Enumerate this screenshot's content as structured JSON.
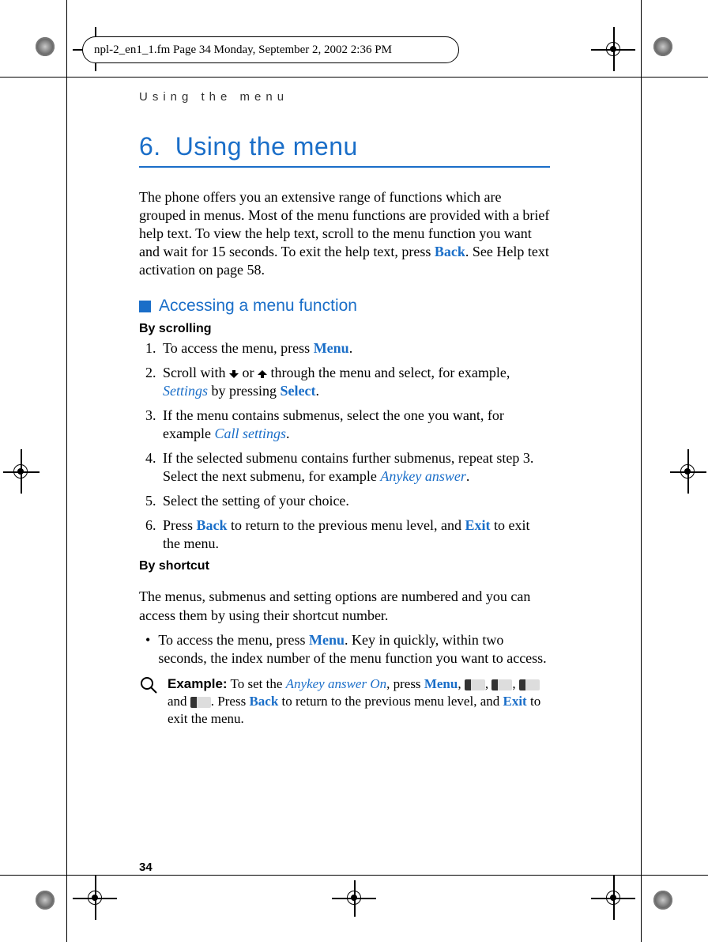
{
  "file_header": "npl-2_en1_1.fm  Page 34  Monday, September 2, 2002  2:36 PM",
  "running_head": "Using the menu",
  "chapter": {
    "num": "6.",
    "title": "Using the menu"
  },
  "intro": {
    "t1": "The phone offers you an extensive range of functions which are grouped in menus. Most of the menu functions are provided with a brief help text. To view the help text, scroll to the menu function you want and wait for 15 seconds. To exit the help text, press ",
    "back": "Back",
    "t2": ". See Help text activation on page 58."
  },
  "section1": {
    "title": "Accessing a menu function",
    "by_scrolling": "By scrolling",
    "steps": {
      "s1_a": "To access the menu, press ",
      "s1_menu": "Menu",
      "s1_b": ".",
      "s2_a": "Scroll with ",
      "s2_b": " or ",
      "s2_c": " through the menu and select, for example, ",
      "s2_settings": "Settings",
      "s2_d": " by pressing ",
      "s2_select": "Select",
      "s2_e": ".",
      "s3_a": "If the menu contains submenus, select the one you want, for example ",
      "s3_call": "Call settings",
      "s3_b": ".",
      "s4_a": "If the selected submenu contains further submenus, repeat step 3. Select the next submenu, for example ",
      "s4_anykey": "Anykey answer",
      "s4_b": ".",
      "s5": "Select the setting of your choice.",
      "s6_a": "Press ",
      "s6_back": "Back",
      "s6_b": " to return to the previous menu level, and ",
      "s6_exit": "Exit",
      "s6_c": " to exit the menu."
    },
    "by_shortcut": "By shortcut",
    "shortcut_intro": "The menus, submenus and setting options are numbered and you can access them by using their shortcut number.",
    "bullet_a": "To access the menu, press ",
    "bullet_menu": "Menu",
    "bullet_b": ". Key in quickly, within two seconds, the index number of the menu function you want to access.",
    "example": {
      "label": "Example:",
      "a": " To set the ",
      "anykey_on": "Anykey answer On",
      "b": ", press ",
      "menu": "Menu",
      "c": ", ",
      "d": ", ",
      "e": ", ",
      "f": " and ",
      "g": ". Press ",
      "back": "Back",
      "h": " to return to the previous menu level, and ",
      "exit": "Exit",
      "i": " to exit the menu."
    }
  },
  "page_number": "34"
}
